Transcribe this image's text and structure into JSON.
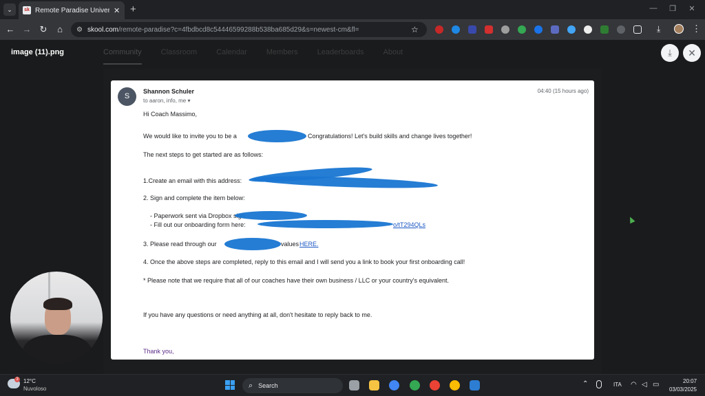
{
  "browser": {
    "tab_title": "Remote Paradise University - W",
    "url_host": "skool.com",
    "url_path": "/remote-paradise?c=4fbdbcd8c54446599288b538ba685d29&s=newest-cm&fl="
  },
  "background_nav": [
    "Community",
    "Classroom",
    "Calendar",
    "Members",
    "Leaderboards",
    "About"
  ],
  "viewer": {
    "filename": "image (11).png"
  },
  "email": {
    "avatar_letter": "S",
    "sender": "Shannon Schuler",
    "recipients": "to aaron, info, me",
    "timestamp": "04:40 (15 hours ago)",
    "greeting": "Hi Coach Massimo,",
    "invite_prefix": "We would like to invite you to be a",
    "invite_suffix": "Congratulations! Let's build skills and change lives together!",
    "next_steps": "The next steps to get started are as follows:",
    "step1": "1.Create an email with this address:",
    "step2": "2. Sign and complete the item below:",
    "step2a": "- Paperwork sent via Dropbox sign",
    "step2b_prefix": "- Fill out our onboarding form here:",
    "step2b_link": "o/tT294QLs",
    "step3_prefix": "3. Please read through our",
    "step3_mid": "values",
    "step3_link": "HERE.",
    "step4": "4. Once the above steps are completed, reply to this email and I will send you a link to book your first onboarding call!",
    "note": "* Please note that we require that all of our coaches have their own business / LLC or your country's equivalent.",
    "questions": "If you have any questions or need anything at all, don't hesitate to reply back to me.",
    "closing": "Thank you,"
  },
  "taskbar": {
    "weather_temp": "12°C",
    "weather_desc": "Nuvoloso",
    "weather_badge": "3",
    "search_label": "Search",
    "language": "ITA",
    "time": "20:07",
    "date": "03/03/2025"
  },
  "icons": {
    "tab_menu": "chevron-down-icon",
    "new_tab": "plus-icon",
    "back": "arrow-left-icon",
    "forward": "arrow-right-icon",
    "reload": "reload-icon",
    "home": "home-icon",
    "bookmark": "star-icon",
    "download": "download-icon",
    "close": "close-icon"
  }
}
